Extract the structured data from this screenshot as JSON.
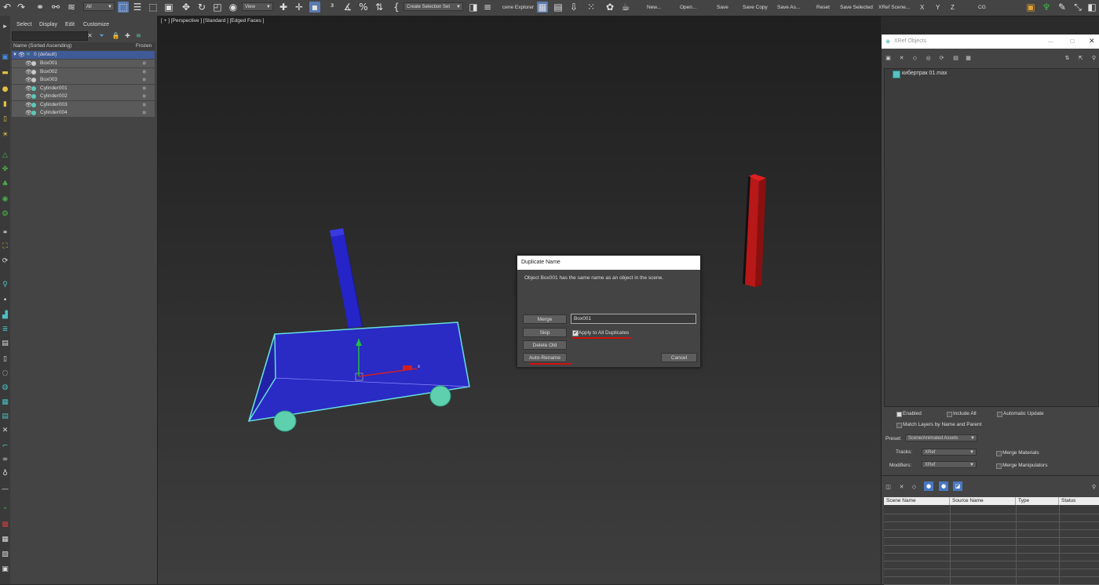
{
  "toolbar": {
    "filter_select": "All",
    "view_select": "View",
    "selection_set": "Create Selection Set",
    "scene_explorer": "cene Explorer",
    "buttons": [
      "New...",
      "Open...",
      "Save",
      "Save Copy",
      "Save As...",
      "Reset",
      "Save Selected",
      "XRef Scene..."
    ],
    "axes": [
      "X",
      "Y",
      "Z"
    ],
    "cg": "CG"
  },
  "explorer": {
    "menu": [
      "Select",
      "Display",
      "Edit",
      "Customize"
    ],
    "col_name": "Name (Sorted Ascending)",
    "col_frozen": "Frozen",
    "layer": "0 (default)",
    "rows": [
      {
        "name": "Box001",
        "color": "#c9c9c9"
      },
      {
        "name": "Box002",
        "color": "#c9c9c9"
      },
      {
        "name": "Box003",
        "color": "#c9c9c9"
      },
      {
        "name": "Cylinder001",
        "color": "#5bc9b8"
      },
      {
        "name": "Cylinder002",
        "color": "#5bc9b8"
      },
      {
        "name": "Cylinder003",
        "color": "#5bc9b8"
      },
      {
        "name": "Cylinder004",
        "color": "#5bc9b8"
      }
    ]
  },
  "viewport": {
    "label": "[ + ] [Perspective ] [Standard ] [Edged Faces ]",
    "gizmo_x": "x"
  },
  "dialog": {
    "title": "Duplicate Name",
    "message": "Object Box001 has the same name as an object in the scene.",
    "merge": "Merge",
    "skip": "Skip",
    "delete_old": "Delete Old",
    "auto_rename": "Auto-Rename",
    "name_value": "Box001",
    "apply_all": "Apply to All Duplicates",
    "cancel": "Cancel"
  },
  "xref": {
    "title": "XRef Objects",
    "file": "кибертрак 01.max",
    "enabled": "Enabled",
    "include_all": "Include All",
    "auto_update": "Automatic Update",
    "match_layers": "Match Layers by Name and Parent",
    "preset_label": "Preset:",
    "preset_value": "Scene/Animated Assets",
    "tracks_label": "Tracks:",
    "tracks_value": "XRef",
    "modifiers_label": "Modifiers:",
    "modifiers_value": "XRef",
    "merge_materials": "Merge Materials",
    "merge_manipulators": "Merge Manipulators",
    "columns": [
      "Scene Name",
      "Source Name",
      "Type",
      "Status"
    ]
  }
}
